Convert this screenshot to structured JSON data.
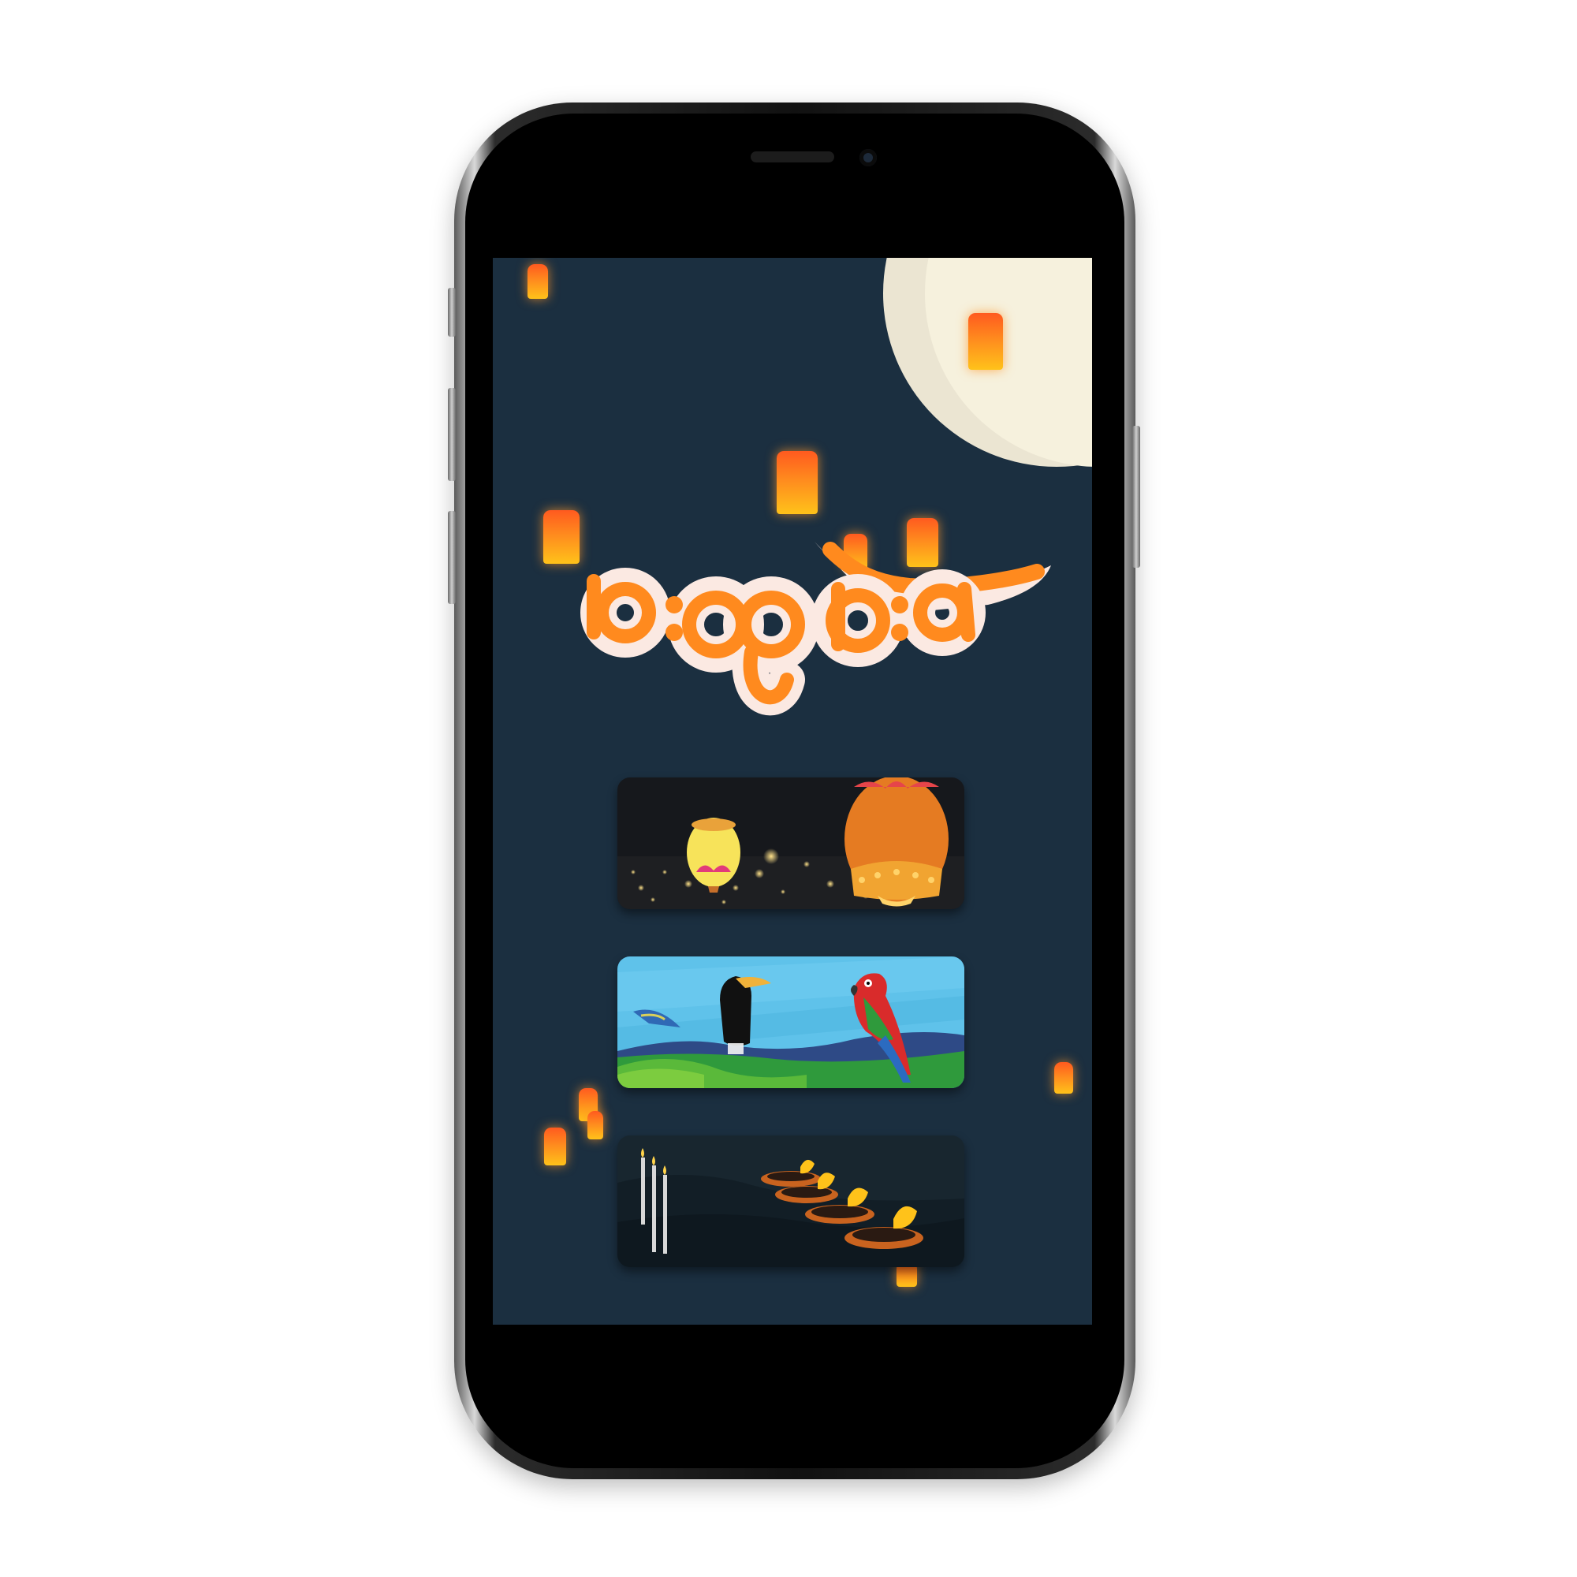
{
  "app": {
    "title": "မီးထွန်းပွဲ"
  },
  "menu": {
    "items": [
      {
        "id": "lanterns",
        "icon": "sky-lantern-banner"
      },
      {
        "id": "birds",
        "icon": "birds-landscape-banner"
      },
      {
        "id": "candles",
        "icon": "oil-lamps-candles-banner"
      }
    ]
  },
  "colors": {
    "background": "#1b2f40",
    "moon": "#f6f1dd",
    "lantern": "#ff8a1e",
    "title": "#ff8a1e"
  }
}
